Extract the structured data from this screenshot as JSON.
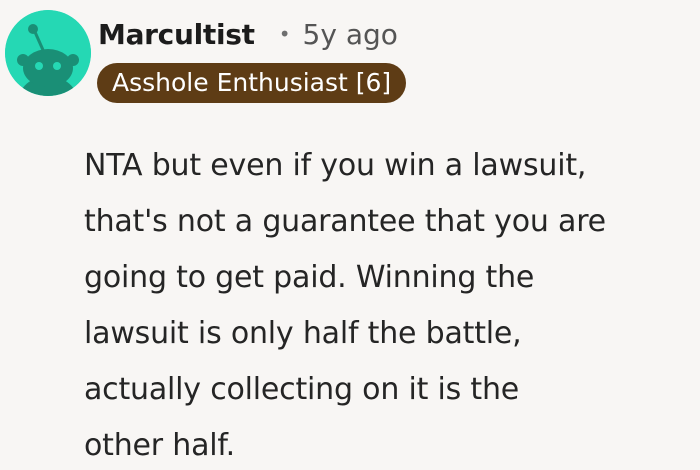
{
  "comment": {
    "author": "Marcultist",
    "separator": "•",
    "timestamp": "5y ago",
    "flair": "Asshole Enthusiast [6]",
    "avatar_icon": "reddit-snoo-avatar-icon",
    "avatar_color": "#25d8b4",
    "flair_color": "#5e3c15",
    "body_lines": [
      "NTA but even if you win a lawsuit,",
      "that's not a guarantee that you are",
      "going to get paid. Winning the",
      "lawsuit is only half the battle,",
      "actually collecting on it is the",
      "other half."
    ]
  }
}
